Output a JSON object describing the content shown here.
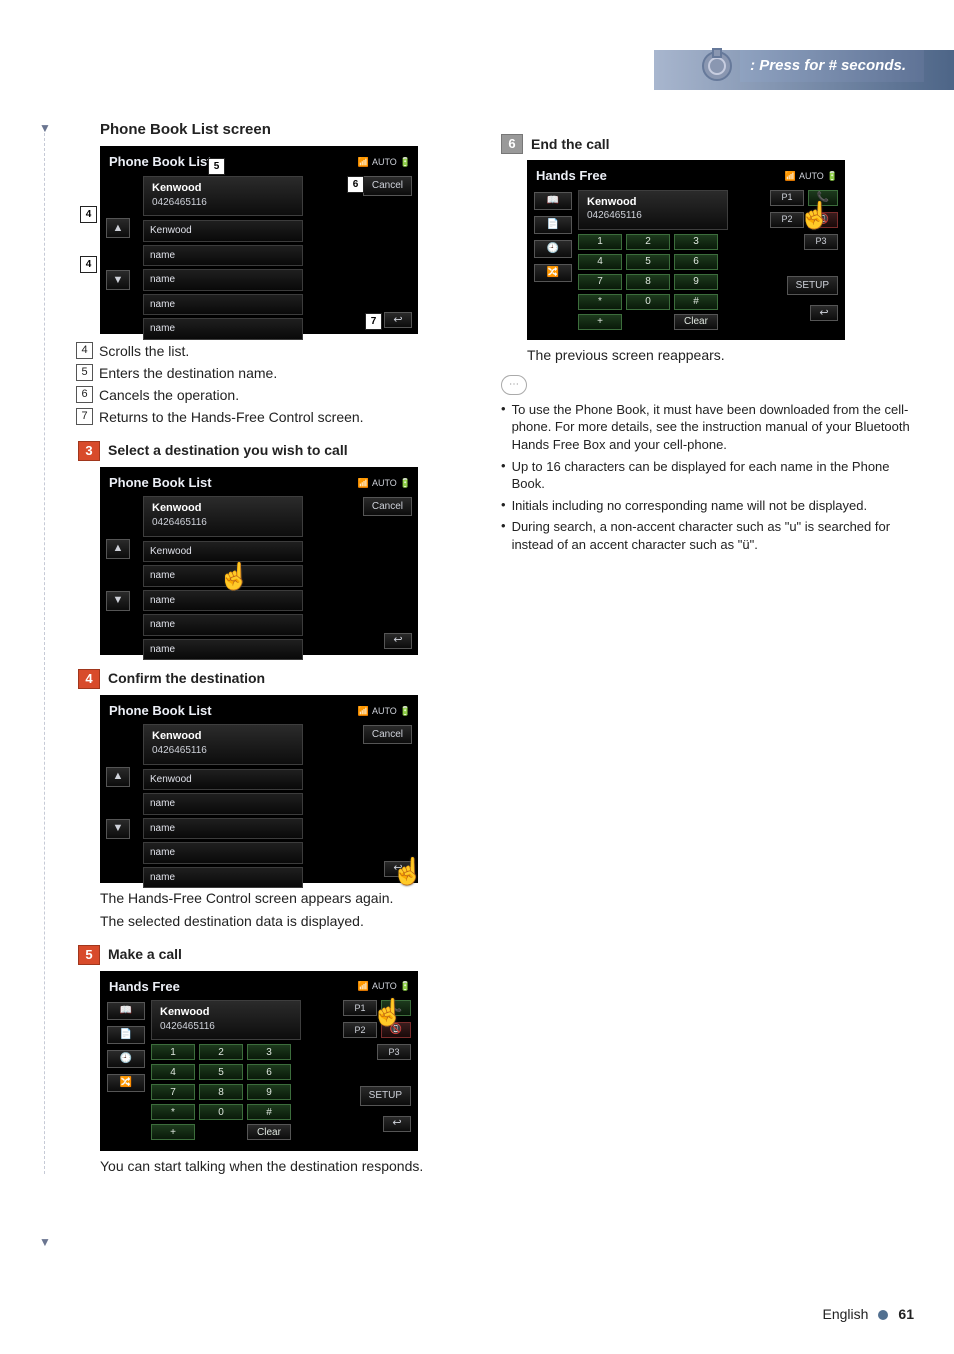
{
  "topbar": {
    "label": ": Press for # seconds."
  },
  "left": {
    "phonebook_heading": "Phone Book List screen",
    "pbl": {
      "title": "Phone Book List",
      "status": {
        "signal": "📶",
        "auto": "AUTO",
        "batt": "🔋"
      },
      "contact_name": "Kenwood",
      "contact_num": "0426465116",
      "rows": [
        "Kenwood",
        "name",
        "name",
        "name",
        "name"
      ],
      "cancel": "Cancel"
    },
    "callouts": {
      "c4a": "4",
      "c4b": "4",
      "c5": "5",
      "c6": "6",
      "c7": "7"
    },
    "desc": [
      {
        "n": "4",
        "t": "Scrolls the list."
      },
      {
        "n": "5",
        "t": "Enters the destination name."
      },
      {
        "n": "6",
        "t": "Cancels the operation."
      },
      {
        "n": "7",
        "t": "Returns to the Hands-Free Control screen."
      }
    ],
    "step3": {
      "num": "3",
      "title": "Select a destination you wish to call"
    },
    "step4": {
      "num": "4",
      "title": "Confirm the destination",
      "text1": "The Hands-Free Control screen appears again.",
      "text2": "The selected destination data is displayed."
    },
    "step5": {
      "num": "5",
      "title": "Make a call",
      "text1": "You can start talking when the destination responds."
    }
  },
  "hf": {
    "title": "Hands Free",
    "contact_name": "Kenwood",
    "contact_num": "0426465116",
    "left_icons": [
      "📖",
      "📄",
      "🕘",
      "🔀"
    ],
    "keys": [
      "1",
      "2",
      "3",
      "4",
      "5",
      "6",
      "7",
      "8",
      "9",
      "*",
      "0",
      "#",
      "+",
      "",
      "Clear"
    ],
    "presets": [
      "P1",
      "P2",
      "P3"
    ],
    "setup": "SETUP"
  },
  "right": {
    "step6": {
      "num": "6",
      "title": "End the call",
      "text": "The previous screen reappears."
    },
    "notes": [
      "To use the Phone Book, it must have been downloaded from the cell-phone. For more details, see the instruction manual of your Bluetooth Hands Free Box and your cell-phone.",
      "Up to 16 characters can be displayed for each name in the Phone Book.",
      "Initials including no corresponding name will not be displayed.",
      "During search, a non-accent character such as \"u\" is searched for instead of an accent character such as \"ü\"."
    ]
  },
  "footer": {
    "lang": "English",
    "page": "61"
  }
}
